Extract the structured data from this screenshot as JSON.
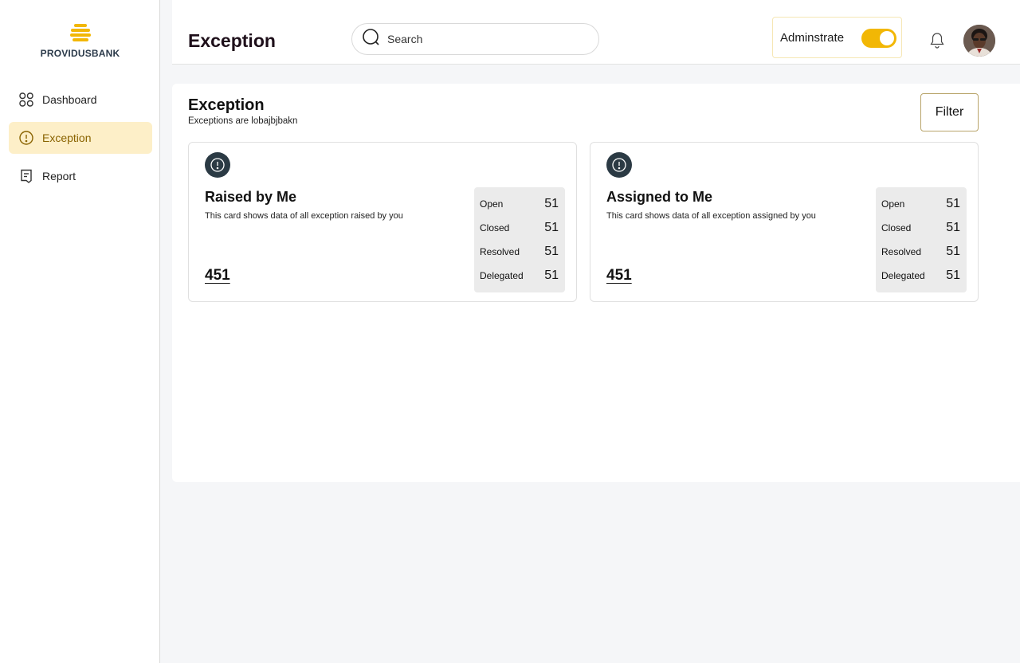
{
  "brand": {
    "name": "PROVIDUSBANK",
    "color": "#f2b705"
  },
  "sidebar": {
    "items": [
      {
        "label": "Dashboard",
        "icon": "grid-icon",
        "active": false
      },
      {
        "label": "Exception",
        "icon": "alert-circle-icon",
        "active": true
      },
      {
        "label": "Report",
        "icon": "report-icon",
        "active": false
      }
    ]
  },
  "header": {
    "title": "Exception",
    "search_placeholder": "Search",
    "admin_label": "Adminstrate",
    "admin_toggle_on": true
  },
  "main": {
    "title": "Exception",
    "subtitle": "Exceptions are lobajbjbakn",
    "filter_label": "Filter",
    "cards": [
      {
        "title": "Raised by Me",
        "description": "This card shows data of all exception raised by you",
        "total": "451",
        "stats": [
          {
            "label": "Open",
            "value": "51"
          },
          {
            "label": "Closed",
            "value": "51"
          },
          {
            "label": "Resolved",
            "value": "51"
          },
          {
            "label": "Delegated",
            "value": "51"
          }
        ]
      },
      {
        "title": "Assigned to Me",
        "description": "This card shows data of all exception assigned by you",
        "total": "451",
        "stats": [
          {
            "label": "Open",
            "value": "51"
          },
          {
            "label": "Closed",
            "value": "51"
          },
          {
            "label": "Resolved",
            "value": "51"
          },
          {
            "label": "Delegated",
            "value": "51"
          }
        ]
      }
    ]
  },
  "colors": {
    "accent": "#f2b705",
    "active_bg": "#fdefc8",
    "icon_dark": "#2b3a44"
  }
}
